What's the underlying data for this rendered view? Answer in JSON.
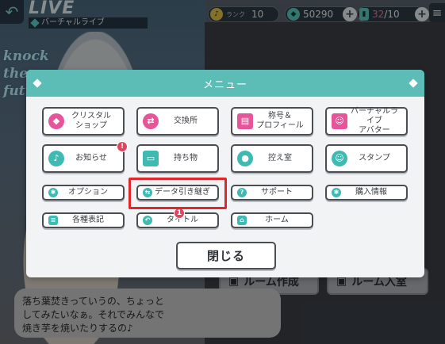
{
  "header": {
    "screen_title": "LIVE",
    "screen_subtitle": "バーチャルライブ",
    "rank_label": "ランク",
    "rank_value": "10",
    "coins": "50290",
    "lives_current": "32",
    "lives_max": "/10"
  },
  "background": {
    "logo_text": "knock the future!!",
    "room_create_label": "ルーム作成",
    "room_join_label": "ルーム入室",
    "dialog_lines": [
      "落ち葉焚きっていうの、ちょっと",
      "してみたいなぁ。それでみんなで",
      "焼き芋を焼いたりするの♪"
    ]
  },
  "menu": {
    "title": "メニュー",
    "items": [
      {
        "label": "クリスタル\nショップ",
        "icon": "crystal-shop-icon"
      },
      {
        "label": "交換所",
        "icon": "exchange-icon"
      },
      {
        "label": "称号＆\nプロフィール",
        "icon": "profile-card-icon"
      },
      {
        "label": "バーチャルライブ\nアバター",
        "icon": "avatar-icon"
      },
      {
        "label": "お知らせ",
        "icon": "bell-icon",
        "badge": "!"
      },
      {
        "label": "持ち物",
        "icon": "bag-icon"
      },
      {
        "label": "控え室",
        "icon": "room-icon"
      },
      {
        "label": "スタンプ",
        "icon": "stamp-icon"
      },
      {
        "label": "オプション",
        "icon": "gear-icon"
      },
      {
        "label": "データ引き継ぎ",
        "icon": "data-transfer-icon"
      },
      {
        "label": "サポート",
        "icon": "support-icon"
      },
      {
        "label": "購入情報",
        "icon": "purchase-info-icon"
      },
      {
        "label": "各種表記",
        "icon": "document-icon"
      },
      {
        "label": "タイトル",
        "icon": "back-arrow-icon",
        "badge": "1"
      },
      {
        "label": "ホーム",
        "icon": "home-icon"
      }
    ],
    "close_label": "閉じる"
  },
  "colors": {
    "header_teal": "#5bbdb6",
    "icon_pink": "#e6559a",
    "icon_teal": "#3fbab2",
    "highlight_red": "#e0282c",
    "badge_red": "#e2445f"
  }
}
